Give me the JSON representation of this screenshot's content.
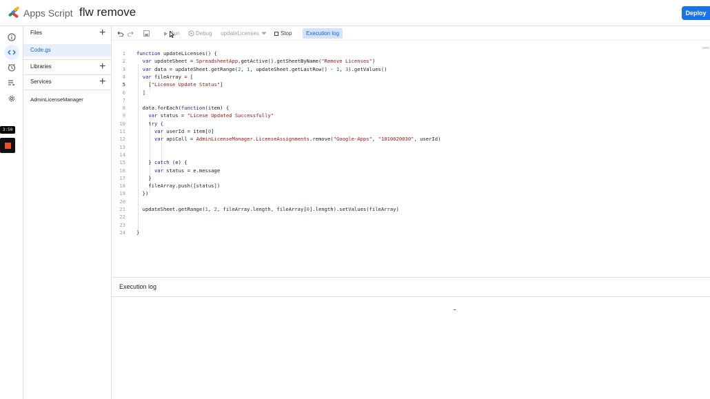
{
  "header": {
    "app_name": "Apps Script",
    "project_title": "flw remove",
    "deploy_label": "Deploy"
  },
  "rail": {
    "icons": [
      "info-icon",
      "code-icon",
      "clock-icon",
      "run-list-icon",
      "gear-icon"
    ],
    "active": "code-icon",
    "timer": "3:50"
  },
  "files_panel": {
    "files_label": "Files",
    "file": "Code.gs",
    "libraries_label": "Libraries",
    "services_label": "Services",
    "library_item": "AdminLicenseManager"
  },
  "toolbar": {
    "run_label": "Run",
    "debug_label": "Debug",
    "function_select": "updateLicenses",
    "stop_label": "Stop",
    "execution_log_label": "Execution log"
  },
  "editor": {
    "current_line": 5,
    "line_numbers": [
      "1",
      "2",
      "3",
      "4",
      "5",
      "6",
      "7",
      "8",
      "9",
      "10",
      "11",
      "12",
      "13",
      "14",
      "15",
      "16",
      "17",
      "18",
      "19",
      "20",
      "21",
      "22",
      "23",
      "24"
    ],
    "lines": [
      "function updateLicenses() {",
      "  var updateSheet = SpreadsheetApp.getActive().getSheetByName(\"Remove Licenses\")",
      "  var data = updateSheet.getRange(2, 1, updateSheet.getLastRow() - 1, 3).getValues()",
      "  var fileArray = [",
      "    [\"License Update Status\"]",
      "  ]",
      "",
      "  data.forEach(function(item) {",
      "    var status = \"Licese Updated Successfully\"",
      "    try {",
      "      var userId = item[0]",
      "      var apiCall = AdminLicenseManager.LicenseAssignments.remove(\"Google-Apps\", \"1010020030\", userId)",
      "",
      "",
      "    } catch (e) {",
      "      var status = e.message",
      "    }",
      "    fileArray.push([status])",
      "  })",
      "",
      "  updateSheet.getRange(1, 2, fileArray.length, fileArray[0].length).setValues(fileArray)",
      "",
      "",
      "}"
    ]
  },
  "execution_log": {
    "title": "Execution log"
  },
  "colors": {
    "accent": "#1a73e8",
    "active_bg": "#e8f0fe",
    "keyword": "#1a1aa6",
    "string": "#a31515",
    "number": "#098658"
  }
}
